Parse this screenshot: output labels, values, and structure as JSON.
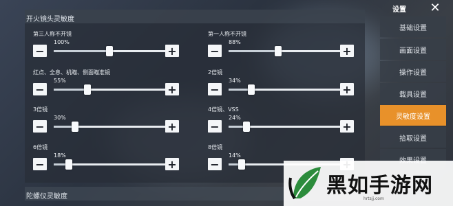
{
  "fire_scope_section": {
    "title": "开火镜头灵敏度"
  },
  "gyro_section": {
    "title": "陀螺仪灵敏度"
  },
  "sliders": [
    {
      "label": "第三人称不开镜",
      "value": "100%",
      "level": 1.0
    },
    {
      "label": "第一人称不开镜",
      "value": "88%",
      "level": 0.88
    },
    {
      "label": "红点、全息、机瞄、侧面瞄准镜",
      "value": "55%",
      "level": 0.55
    },
    {
      "label": "2倍镜",
      "value": "34%",
      "level": 0.34
    },
    {
      "label": "3倍镜",
      "value": "30%",
      "level": 0.3
    },
    {
      "label": "4倍镜、VSS",
      "value": "24%",
      "level": 0.24
    },
    {
      "label": "6倍镜",
      "value": "18%",
      "level": 0.18
    },
    {
      "label": "8倍镜",
      "value": "14%",
      "level": 0.14
    }
  ],
  "buttons": {
    "minus": "−",
    "plus": "+"
  },
  "sidebar": {
    "title": "设置",
    "close": "✕",
    "items": [
      {
        "label": "基础设置"
      },
      {
        "label": "画面设置"
      },
      {
        "label": "操作设置"
      },
      {
        "label": "载具设置"
      },
      {
        "label": "灵敏度设置"
      },
      {
        "label": "拾取设置"
      },
      {
        "label": "效果设置"
      }
    ]
  },
  "watermark": {
    "name": "黑如手游网",
    "url": "hrtsjj.com"
  },
  "colors": {
    "accent": "#e8912a",
    "panel": "#2b3340"
  }
}
